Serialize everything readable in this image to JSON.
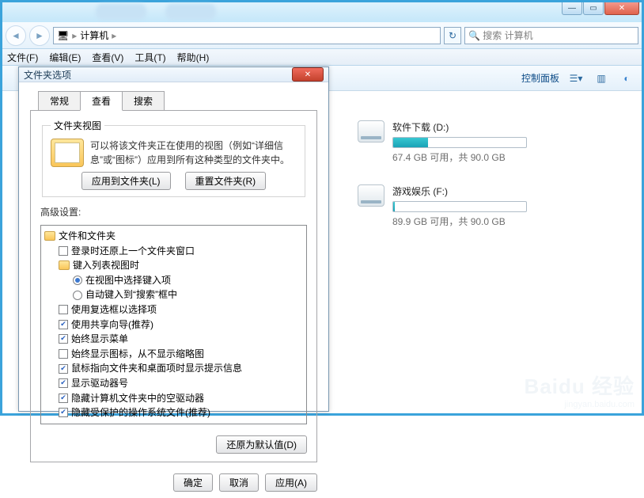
{
  "chrome": {
    "breadcrumb": "计算机",
    "search_placeholder": "搜索 计算机",
    "menus": [
      "文件(F)",
      "编辑(E)",
      "查看(V)",
      "工具(T)",
      "帮助(H)"
    ],
    "panel_link": "控制面板"
  },
  "drives": [
    {
      "name": "软件下载 (D:)",
      "free": "67.4 GB 可用，共 90.0 GB",
      "pct": 26
    },
    {
      "name": "游戏娱乐 (F:)",
      "free": "89.9 GB 可用，共 90.0 GB",
      "pct": 1
    }
  ],
  "dlg": {
    "title": "文件夹选项",
    "tabs": [
      "常规",
      "查看",
      "搜索"
    ],
    "active_tab": 1,
    "view_group": "文件夹视图",
    "view_desc": "可以将该文件夹正在使用的视图（例如“详细信息”或“图标”）应用到所有这种类型的文件夹中。",
    "apply_views_btn": "应用到文件夹(L)",
    "reset_views_btn": "重置文件夹(R)",
    "adv_label": "高级设置:",
    "restore_btn": "还原为默认值(D)",
    "ok_btn": "确定",
    "cancel_btn": "取消",
    "apply_btn": "应用(A)",
    "tree": {
      "root": "文件和文件夹",
      "items": [
        {
          "t": "chk",
          "on": false,
          "label": "登录时还原上一个文件夹窗口"
        },
        {
          "t": "folder",
          "label": "键入列表视图时",
          "children": [
            {
              "t": "rad",
              "on": true,
              "label": "在视图中选择键入项"
            },
            {
              "t": "rad",
              "on": false,
              "label": "自动键入到“搜索”框中"
            }
          ]
        },
        {
          "t": "chk",
          "on": false,
          "label": "使用复选框以选择项"
        },
        {
          "t": "chk",
          "on": true,
          "label": "使用共享向导(推荐)"
        },
        {
          "t": "chk",
          "on": true,
          "label": "始终显示菜单"
        },
        {
          "t": "chk",
          "on": false,
          "label": "始终显示图标，从不显示缩略图"
        },
        {
          "t": "chk",
          "on": true,
          "label": "鼠标指向文件夹和桌面项时显示提示信息"
        },
        {
          "t": "chk",
          "on": true,
          "label": "显示驱动器号"
        },
        {
          "t": "chk",
          "on": true,
          "label": "隐藏计算机文件夹中的空驱动器"
        },
        {
          "t": "chk",
          "on": true,
          "label": "隐藏受保护的操作系统文件(推荐)"
        }
      ]
    }
  },
  "watermark": {
    "big": "Baidu 经验",
    "small": "jingyan.baidu.com"
  }
}
